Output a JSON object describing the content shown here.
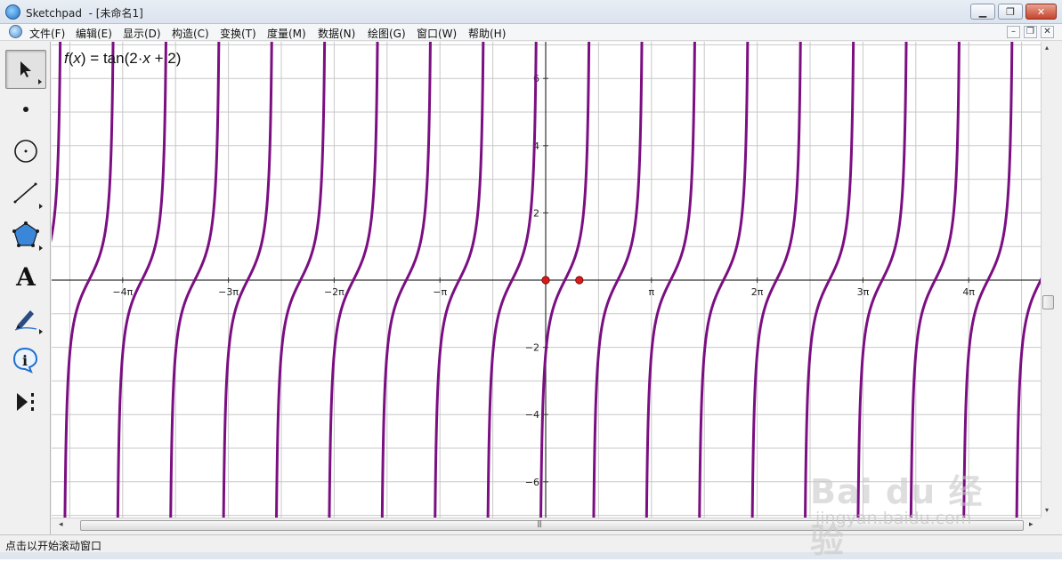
{
  "window": {
    "title": "Sketchpad  - [未命名1]",
    "min_label": "▁",
    "max_label": "❐",
    "close_label": "✕"
  },
  "menu": {
    "items": [
      "文件(F)",
      "编辑(E)",
      "显示(D)",
      "构造(C)",
      "变换(T)",
      "度量(M)",
      "数据(N)",
      "绘图(G)",
      "窗口(W)",
      "帮助(H)"
    ],
    "mdi_min": "–",
    "mdi_restore": "❐",
    "mdi_close": "✕"
  },
  "toolbox": {
    "tools": [
      {
        "name": "arrow-tool",
        "icon": "arrow-icon",
        "selected": true
      },
      {
        "name": "point-tool",
        "icon": "point-icon"
      },
      {
        "name": "compass-tool",
        "icon": "circle-icon"
      },
      {
        "name": "straightedge-tool",
        "icon": "line-icon"
      },
      {
        "name": "polygon-tool",
        "icon": "pentagon-icon"
      },
      {
        "name": "text-tool",
        "icon": "text-a-icon"
      },
      {
        "name": "marker-tool",
        "icon": "marker-pen-icon"
      },
      {
        "name": "information-tool",
        "icon": "info-icon"
      },
      {
        "name": "custom-tool",
        "icon": "custom-tool-icon"
      }
    ],
    "text_glyph": "A"
  },
  "graph": {
    "function_label": {
      "f": "f",
      "x": "x",
      "rest_1": ") = tan(2·",
      "rest_2": " + 2)"
    },
    "y_tick_labels": [
      "6",
      "4",
      "2",
      "−2",
      "−4",
      "−6"
    ],
    "x_tick_labels": [
      "−4π",
      "−3π",
      "−2π",
      "−π",
      "π",
      "2π",
      "3π",
      "4π"
    ],
    "curve_color": "#7b0f82",
    "point_color": "#d81b1b",
    "axis_color": "#333333",
    "grid_color": "#c8c8c8"
  },
  "chart_data": {
    "type": "line",
    "title": "f(x) = tan(2·x + 2)",
    "function": "tan(2*x + 2)",
    "xlim": [
      -4.7,
      4.7
    ],
    "xlim_units": "π",
    "ylim": [
      -7,
      7
    ],
    "x_ticks": [
      "−4π",
      "−3π",
      "−2π",
      "−π",
      "π",
      "2π",
      "3π",
      "4π"
    ],
    "y_ticks": [
      6,
      4,
      2,
      -2,
      -4,
      -6
    ],
    "grid": true,
    "points": [
      {
        "x": 0,
        "y": 0
      },
      {
        "x": 1,
        "y": 0
      }
    ],
    "series": [
      {
        "values_description": "periodic tangent branches, period π/2"
      }
    ]
  },
  "scroll": {
    "grip": "|||",
    "left_arrow": "◂",
    "right_arrow": "▸",
    "up_arrow": "▴",
    "down_arrow": "▾"
  },
  "status": {
    "text": "点击以开始滚动窗口"
  },
  "watermark": {
    "main": "Bai du 经验",
    "sub": "jingyan.baidu.com"
  }
}
